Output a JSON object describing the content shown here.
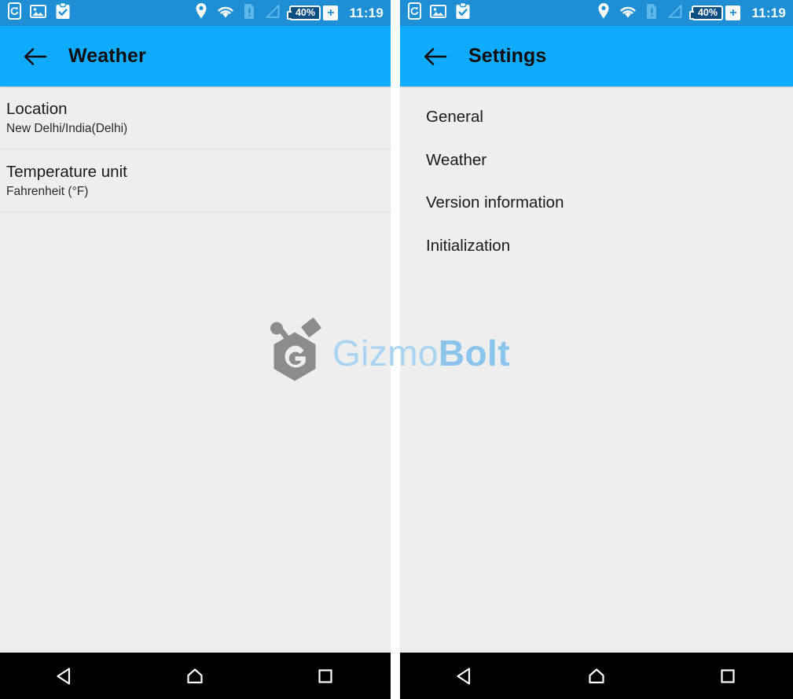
{
  "screens": [
    {
      "id": "weather-prefs",
      "statusbar": {
        "left_icons": [
          "phone-sync-icon",
          "image-icon",
          "clipboard-check-icon"
        ],
        "right_icons": [
          "location-pin-icon",
          "wifi-icon",
          "sim-alert-icon",
          "signal-icon"
        ],
        "battery_level": "40%",
        "battery_mode": "+",
        "time": "11:19"
      },
      "appbar": {
        "back_icon": "arrow-left-icon",
        "title": "Weather"
      },
      "preferences": [
        {
          "title": "Location",
          "summary": "New Delhi/India(Delhi)"
        },
        {
          "title": "Temperature unit",
          "summary": "Fahrenheit (°F)"
        }
      ],
      "navbar": {
        "back": "back-triangle-icon",
        "home": "home-icon",
        "recents": "recents-square-icon"
      }
    },
    {
      "id": "settings",
      "statusbar": {
        "left_icons": [
          "phone-sync-icon",
          "image-icon",
          "clipboard-check-icon"
        ],
        "right_icons": [
          "location-pin-icon",
          "wifi-icon",
          "sim-alert-icon",
          "signal-icon"
        ],
        "battery_level": "40%",
        "battery_mode": "+",
        "time": "11:19"
      },
      "appbar": {
        "back_icon": "arrow-left-icon",
        "title": "Settings"
      },
      "items": [
        {
          "label": "General"
        },
        {
          "label": "Weather"
        },
        {
          "label": "Version information"
        },
        {
          "label": "Initialization"
        }
      ],
      "navbar": {
        "back": "back-triangle-icon",
        "home": "home-icon",
        "recents": "recents-square-icon"
      }
    }
  ],
  "watermark": {
    "text_light": "Gizmo",
    "text_bold": "Bolt",
    "logo": "gizmobolt-hexagon-logo"
  },
  "colors": {
    "statusbar": "#1e8fd4",
    "appbar": "#0eabff",
    "content_bg": "#eeeeee",
    "divider": "#e0e0e0",
    "navbar": "#000000",
    "title_text": "#0d0d0d",
    "watermark_light": "#a8d4f2",
    "watermark_bold": "#8bc4ec"
  }
}
